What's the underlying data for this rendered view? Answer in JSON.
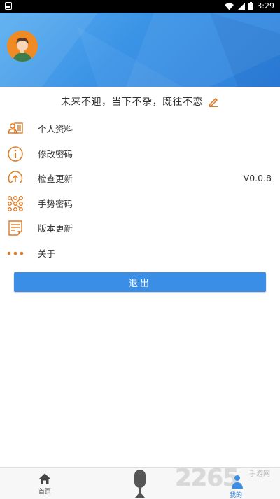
{
  "status_bar": {
    "time": "3:29"
  },
  "profile": {
    "motto": "未来不迎，当下不杂，既往不恋"
  },
  "menu": [
    {
      "label": "个人资料",
      "icon": "profile-card-icon"
    },
    {
      "label": "修改密码",
      "icon": "info-circle-icon"
    },
    {
      "label": "检查更新",
      "icon": "update-circle-icon",
      "value": "V0.0.8"
    },
    {
      "label": "手势密码",
      "icon": "gesture-grid-icon"
    },
    {
      "label": "版本更新",
      "icon": "document-icon"
    },
    {
      "label": "关于",
      "icon": "more-dots-icon"
    }
  ],
  "logout_label": "退出",
  "bottom_nav": {
    "home_label": "首页",
    "mine_label": "我的"
  },
  "watermark": {
    "text": "2265",
    "sub": "手游网"
  },
  "colors": {
    "accent": "#3a8ee6",
    "icon": "#e07a1f",
    "header": "#3b93e6"
  }
}
